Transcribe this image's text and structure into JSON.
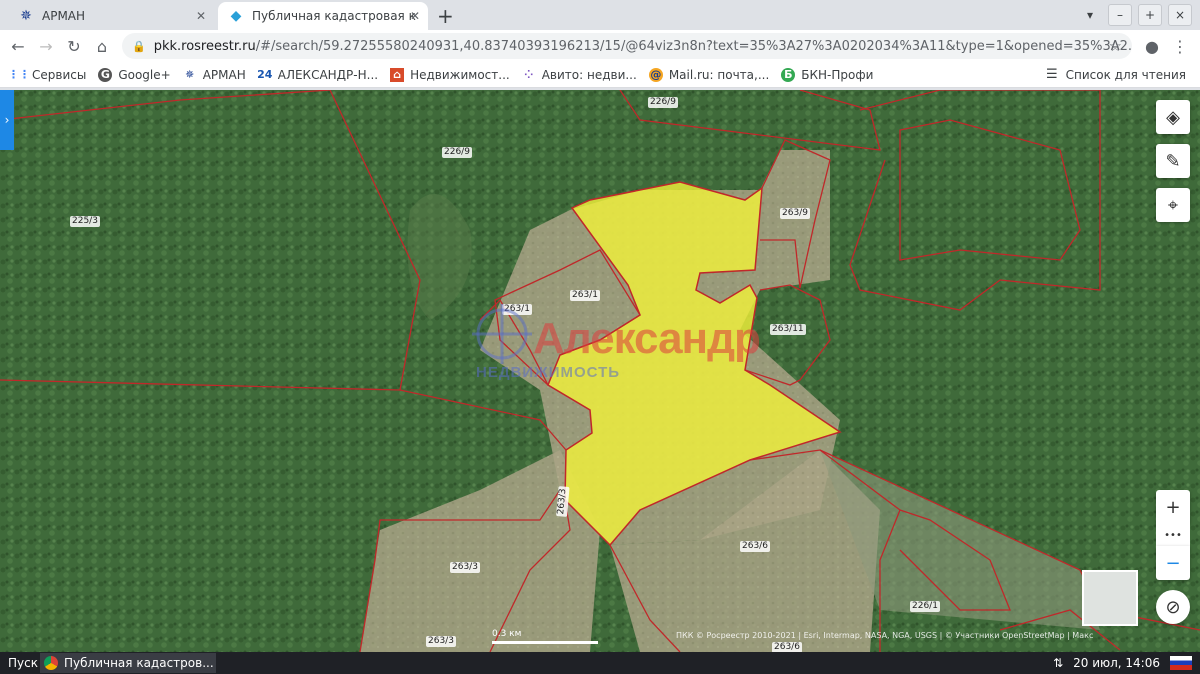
{
  "tabs": [
    {
      "label": "АРМАН",
      "icon": "helm-icon",
      "active": false
    },
    {
      "label": "Публичная кадастровая к",
      "icon": "rosreestr-icon",
      "active": true
    }
  ],
  "window_buttons": [
    "▾",
    "–",
    "+",
    "×"
  ],
  "address": {
    "domain": "pkk.rosreestr.ru",
    "path": "/#/search/59.27255580240931,40.83740393196213/15/@64viz3n8n?text=35%3A27%3A0202034%3A11&type=1&opened=35%3A2..."
  },
  "bookmarks": [
    {
      "label": "Сервисы",
      "icon": "apps-grid-icon"
    },
    {
      "label": "Google+",
      "icon": "google-plus-icon"
    },
    {
      "label": "АРМАН",
      "icon": "helm-icon"
    },
    {
      "label": "АЛЕКСАНДР-Н...",
      "icon": "number-24-icon"
    },
    {
      "label": "Недвижимост...",
      "icon": "realty-icon"
    },
    {
      "label": "Авито: недви...",
      "icon": "avito-icon"
    },
    {
      "label": "Mail.ru: почта,...",
      "icon": "mail-at-icon"
    },
    {
      "label": "БКН-Профи",
      "icon": "bkn-icon"
    }
  ],
  "reading_list": "Список для чтения",
  "map": {
    "parcel_labels": [
      {
        "text": "226/9",
        "id": "a"
      },
      {
        "text": "226/9",
        "id": "b"
      },
      {
        "text": "225/3",
        "id": "c"
      },
      {
        "text": "263/9",
        "id": "d"
      },
      {
        "text": "263/1",
        "id": "e"
      },
      {
        "text": "263/1",
        "id": "f"
      },
      {
        "text": "263/11",
        "id": "g"
      },
      {
        "text": "263/3",
        "id": "h"
      },
      {
        "text": "263/3",
        "id": "i"
      },
      {
        "text": "263/6",
        "id": "j"
      },
      {
        "text": "226/1",
        "id": "k"
      },
      {
        "text": "263/3",
        "id": "l"
      },
      {
        "text": "263/6",
        "id": "m"
      }
    ],
    "watermark_title": "Александр",
    "watermark_subtitle": "НЕДВИЖИМОСТЬ",
    "scale_label": "0.3 км",
    "attribution": "ПКК © Росреестр 2010-2021 | Esri, Intermap, NASA, NGA, USGS | © Участники OpenStreetMap | Макс",
    "controls": {
      "zoom_in": "+",
      "more": "•••",
      "zoom_out": "−"
    },
    "highlight_color": "#f2f23a",
    "boundary_color": "#c0282a"
  },
  "taskbar": {
    "start": "Пуск",
    "window_title": "Публичная кадастров...",
    "clock": "20 июл, 14:06"
  }
}
